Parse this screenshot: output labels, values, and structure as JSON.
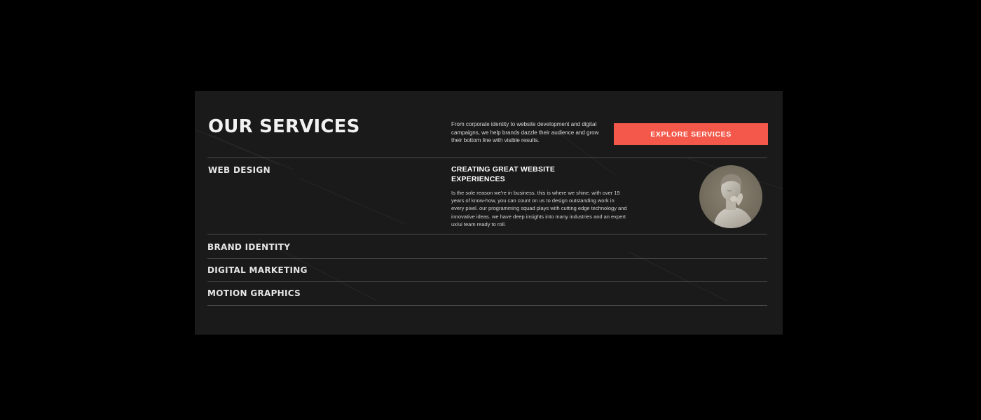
{
  "header": {
    "title": "OUR SERVICES",
    "intro": "From corporate identity to website development and digital campaigns, we help brands dazzle their audience and grow their bottom line with visible results.",
    "cta_label": "EXPLORE SERVICES"
  },
  "services": {
    "active": {
      "name": "WEB DESIGN",
      "heading": "CREATING GREAT WEBSITE EXPERIENCES",
      "description": "Is the sole reason we're in business. this is where we shine. with over 15 years of know-how, you can count on us to design outstanding work in every pixel. our programming squad plays with cutting edge technology and innovative ideas. we have deep insights into many industries and an expert ux/ui team ready to roll."
    },
    "items": [
      {
        "name": "BRAND IDENTITY"
      },
      {
        "name": "DIGITAL MARKETING"
      },
      {
        "name": "MOTION GRAPHICS"
      }
    ]
  },
  "icons": {
    "statue": "statue-image"
  },
  "colors": {
    "background": "#000000",
    "panel": "#1a1a1a",
    "accent": "#f4584a",
    "text": "#f2f2f2",
    "divider": "#4b4b4b"
  }
}
